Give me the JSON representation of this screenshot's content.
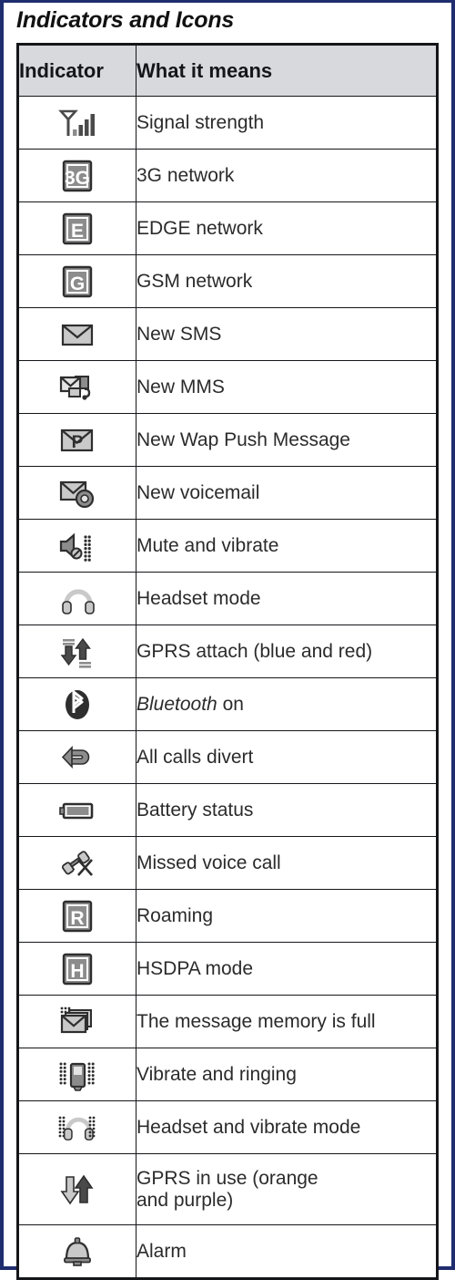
{
  "title": "Indicators and Icons",
  "table": {
    "headers": [
      "Indicator",
      "What it means"
    ],
    "rows": [
      {
        "icon": "signal-strength-icon",
        "meaning": "Signal strength"
      },
      {
        "icon": "3g-network-icon",
        "meaning": "3G network"
      },
      {
        "icon": "edge-network-icon",
        "meaning": "EDGE network"
      },
      {
        "icon": "gsm-network-icon",
        "meaning": "GSM network"
      },
      {
        "icon": "new-sms-icon",
        "meaning": "New SMS"
      },
      {
        "icon": "new-mms-icon",
        "meaning": "New MMS"
      },
      {
        "icon": "new-wap-push-icon",
        "meaning": "New Wap Push Message"
      },
      {
        "icon": "new-voicemail-icon",
        "meaning": "New voicemail"
      },
      {
        "icon": "mute-vibrate-icon",
        "meaning": "Mute and vibrate"
      },
      {
        "icon": "headset-icon",
        "meaning": "Headset mode"
      },
      {
        "icon": "gprs-attach-icon",
        "meaning": "GPRS attach (blue and red)"
      },
      {
        "icon": "bluetooth-icon",
        "meaning": "Bluetooth on",
        "emphasis": "Bluetooth",
        "rest": " on"
      },
      {
        "icon": "call-divert-icon",
        "meaning": "All calls divert"
      },
      {
        "icon": "battery-icon",
        "meaning": "Battery status"
      },
      {
        "icon": "missed-call-icon",
        "meaning": "Missed voice call"
      },
      {
        "icon": "roaming-icon",
        "meaning": "Roaming"
      },
      {
        "icon": "hsdpa-icon",
        "meaning": "HSDPA mode"
      },
      {
        "icon": "message-memory-full-icon",
        "meaning": "The message memory is full"
      },
      {
        "icon": "vibrate-ringing-icon",
        "meaning": "Vibrate and ringing"
      },
      {
        "icon": "headset-vibrate-icon",
        "meaning": "Headset and vibrate mode"
      },
      {
        "icon": "gprs-in-use-icon",
        "meaning": "GPRS in use (orange\nand purple)"
      },
      {
        "icon": "alarm-icon",
        "meaning": "Alarm"
      }
    ]
  },
  "colors": {
    "frame": "#1f2d6e",
    "header_fill": "#d7d9dd",
    "grid": "#15161a",
    "text": "#2b2b2b",
    "icon_dark": "#4a4a4a",
    "icon_mid": "#8c8c8c",
    "icon_light": "#c9c9c9"
  }
}
